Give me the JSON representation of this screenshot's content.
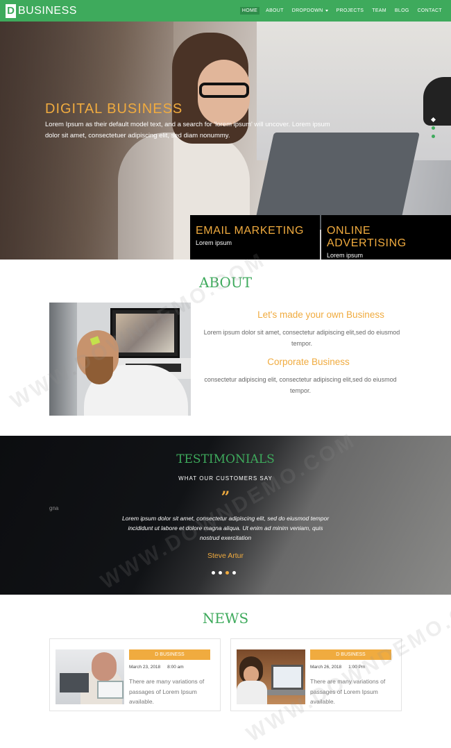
{
  "nav": {
    "logo_letter": "D",
    "logo_text": "BUSINESS",
    "items": [
      "HOME",
      "ABOUT",
      "DROPDOWN",
      "PROJECTS",
      "TEAM",
      "BLOG",
      "CONTACT"
    ],
    "active_index": 0
  },
  "hero": {
    "title": "DIGITAL BUSINESS",
    "text": "Lorem Ipsum as their default model text, and a search for 'lorem ipsum' will uncover. Lorem ipsum dolor sit amet, consectetuer adipiscing elit, sed diam nonummy.",
    "slider_dots": 3,
    "boxes": [
      {
        "title": "EMAIL MARKETING",
        "subtitle": "Lorem ipsum"
      },
      {
        "title": "ONLINE ADVERTISING",
        "subtitle": "Lorem ipsum"
      }
    ]
  },
  "about": {
    "title": "ABOUT",
    "heading1": "Let's made your own Business",
    "text1": "Lorem ipsum dolor sit amet, consectetur adipiscing elit,sed do eiusmod tempor.",
    "heading2": "Corporate Business",
    "text2": "consectetur adipiscing elit, consectetur adipiscing elit,sed do eiusmod tempor."
  },
  "testimonials": {
    "title": "TESTIMONIALS",
    "subtitle": "WHAT OUR CUSTOMERS SAY",
    "quote_mark": "”",
    "side_text": "gna",
    "quote": "Lorem ipsum dolor sit amet, consectetur adipiscing elit, sed do eiusmod tempor incididunt ut labore et dolore magna aliqua. Ut enim ad minim veniam, quis nostrud exercitation",
    "author": "Steve Artur",
    "dots": 4,
    "active_dot": 2
  },
  "news": {
    "title": "NEWS",
    "cards": [
      {
        "badge": "D BUSINESS",
        "date": "March 23, 2018",
        "time": "8:00 am",
        "text": "There are many variations of passages of Lorem Ipsum available."
      },
      {
        "badge": "D BUSINESS",
        "date": "March 26, 2018",
        "time": "1:00 Pm",
        "text": "There are many variations of passages of Lorem Ipsum available."
      }
    ]
  },
  "watermark": "WWW.DOWNDEMO.COM",
  "colors": {
    "brand_green": "#3eaa5c",
    "accent_orange": "#f0ab3f",
    "dark": "#000000"
  }
}
